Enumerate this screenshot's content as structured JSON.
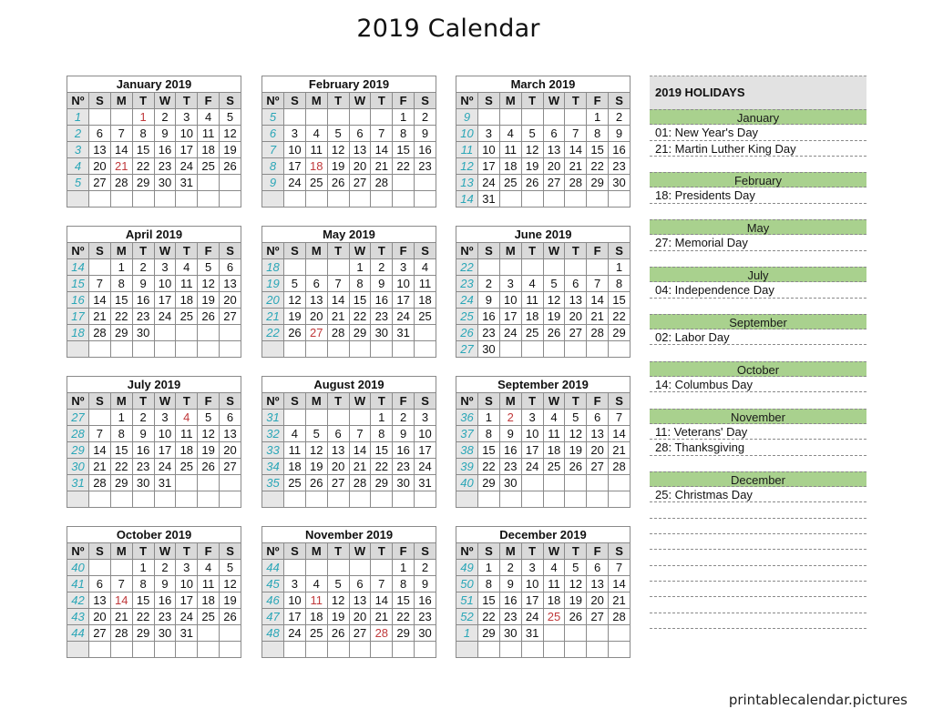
{
  "title": "2019 Calendar",
  "footer": "printablecalendar.pictures",
  "colors": {
    "holiday_text": "#c0393b",
    "week_number": "#2aa6b7",
    "holiday_band": "#a9d18e",
    "header_gray": "#d9d9d9"
  },
  "dow_labels": [
    "Nº",
    "S",
    "M",
    "T",
    "W",
    "T",
    "F",
    "S"
  ],
  "months": [
    {
      "name": "January 2019",
      "weeks": [
        {
          "wk": "1",
          "days": [
            "",
            "",
            "1",
            "2",
            "3",
            "4",
            "5"
          ]
        },
        {
          "wk": "2",
          "days": [
            "6",
            "7",
            "8",
            "9",
            "10",
            "11",
            "12"
          ]
        },
        {
          "wk": "3",
          "days": [
            "13",
            "14",
            "15",
            "16",
            "17",
            "18",
            "19"
          ]
        },
        {
          "wk": "4",
          "days": [
            "20",
            "21",
            "22",
            "23",
            "24",
            "25",
            "26"
          ]
        },
        {
          "wk": "5",
          "days": [
            "27",
            "28",
            "29",
            "30",
            "31",
            "",
            ""
          ]
        },
        {
          "wk": "",
          "days": [
            "",
            "",
            "",
            "",
            "",
            "",
            ""
          ]
        }
      ],
      "holidays": [
        "1",
        "21"
      ]
    },
    {
      "name": "February 2019",
      "weeks": [
        {
          "wk": "5",
          "days": [
            "",
            "",
            "",
            "",
            "",
            "1",
            "2"
          ]
        },
        {
          "wk": "6",
          "days": [
            "3",
            "4",
            "5",
            "6",
            "7",
            "8",
            "9"
          ]
        },
        {
          "wk": "7",
          "days": [
            "10",
            "11",
            "12",
            "13",
            "14",
            "15",
            "16"
          ]
        },
        {
          "wk": "8",
          "days": [
            "17",
            "18",
            "19",
            "20",
            "21",
            "22",
            "23"
          ]
        },
        {
          "wk": "9",
          "days": [
            "24",
            "25",
            "26",
            "27",
            "28",
            "",
            ""
          ]
        },
        {
          "wk": "",
          "days": [
            "",
            "",
            "",
            "",
            "",
            "",
            ""
          ]
        }
      ],
      "holidays": [
        "18"
      ]
    },
    {
      "name": "March 2019",
      "weeks": [
        {
          "wk": "9",
          "days": [
            "",
            "",
            "",
            "",
            "",
            "1",
            "2"
          ]
        },
        {
          "wk": "10",
          "days": [
            "3",
            "4",
            "5",
            "6",
            "7",
            "8",
            "9"
          ]
        },
        {
          "wk": "11",
          "days": [
            "10",
            "11",
            "12",
            "13",
            "14",
            "15",
            "16"
          ]
        },
        {
          "wk": "12",
          "days": [
            "17",
            "18",
            "19",
            "20",
            "21",
            "22",
            "23"
          ]
        },
        {
          "wk": "13",
          "days": [
            "24",
            "25",
            "26",
            "27",
            "28",
            "29",
            "30"
          ]
        },
        {
          "wk": "14",
          "days": [
            "31",
            "",
            "",
            "",
            "",
            "",
            ""
          ]
        }
      ],
      "holidays": []
    },
    {
      "name": "April 2019",
      "weeks": [
        {
          "wk": "14",
          "days": [
            "",
            "1",
            "2",
            "3",
            "4",
            "5",
            "6"
          ]
        },
        {
          "wk": "15",
          "days": [
            "7",
            "8",
            "9",
            "10",
            "11",
            "12",
            "13"
          ]
        },
        {
          "wk": "16",
          "days": [
            "14",
            "15",
            "16",
            "17",
            "18",
            "19",
            "20"
          ]
        },
        {
          "wk": "17",
          "days": [
            "21",
            "22",
            "23",
            "24",
            "25",
            "26",
            "27"
          ]
        },
        {
          "wk": "18",
          "days": [
            "28",
            "29",
            "30",
            "",
            "",
            "",
            ""
          ]
        },
        {
          "wk": "",
          "days": [
            "",
            "",
            "",
            "",
            "",
            "",
            ""
          ]
        }
      ],
      "holidays": []
    },
    {
      "name": "May 2019",
      "weeks": [
        {
          "wk": "18",
          "days": [
            "",
            "",
            "",
            "1",
            "2",
            "3",
            "4"
          ]
        },
        {
          "wk": "19",
          "days": [
            "5",
            "6",
            "7",
            "8",
            "9",
            "10",
            "11"
          ]
        },
        {
          "wk": "20",
          "days": [
            "12",
            "13",
            "14",
            "15",
            "16",
            "17",
            "18"
          ]
        },
        {
          "wk": "21",
          "days": [
            "19",
            "20",
            "21",
            "22",
            "23",
            "24",
            "25"
          ]
        },
        {
          "wk": "22",
          "days": [
            "26",
            "27",
            "28",
            "29",
            "30",
            "31",
            ""
          ]
        },
        {
          "wk": "",
          "days": [
            "",
            "",
            "",
            "",
            "",
            "",
            ""
          ]
        }
      ],
      "holidays": [
        "27"
      ]
    },
    {
      "name": "June 2019",
      "weeks": [
        {
          "wk": "22",
          "days": [
            "",
            "",
            "",
            "",
            "",
            "",
            "1"
          ]
        },
        {
          "wk": "23",
          "days": [
            "2",
            "3",
            "4",
            "5",
            "6",
            "7",
            "8"
          ]
        },
        {
          "wk": "24",
          "days": [
            "9",
            "10",
            "11",
            "12",
            "13",
            "14",
            "15"
          ]
        },
        {
          "wk": "25",
          "days": [
            "16",
            "17",
            "18",
            "19",
            "20",
            "21",
            "22"
          ]
        },
        {
          "wk": "26",
          "days": [
            "23",
            "24",
            "25",
            "26",
            "27",
            "28",
            "29"
          ]
        },
        {
          "wk": "27",
          "days": [
            "30",
            "",
            "",
            "",
            "",
            "",
            ""
          ]
        }
      ],
      "holidays": []
    },
    {
      "name": "July 2019",
      "weeks": [
        {
          "wk": "27",
          "days": [
            "",
            "1",
            "2",
            "3",
            "4",
            "5",
            "6"
          ]
        },
        {
          "wk": "28",
          "days": [
            "7",
            "8",
            "9",
            "10",
            "11",
            "12",
            "13"
          ]
        },
        {
          "wk": "29",
          "days": [
            "14",
            "15",
            "16",
            "17",
            "18",
            "19",
            "20"
          ]
        },
        {
          "wk": "30",
          "days": [
            "21",
            "22",
            "23",
            "24",
            "25",
            "26",
            "27"
          ]
        },
        {
          "wk": "31",
          "days": [
            "28",
            "29",
            "30",
            "31",
            "",
            "",
            ""
          ]
        },
        {
          "wk": "",
          "days": [
            "",
            "",
            "",
            "",
            "",
            "",
            ""
          ]
        }
      ],
      "holidays": [
        "4"
      ]
    },
    {
      "name": "August 2019",
      "weeks": [
        {
          "wk": "31",
          "days": [
            "",
            "",
            "",
            "",
            "1",
            "2",
            "3"
          ]
        },
        {
          "wk": "32",
          "days": [
            "4",
            "5",
            "6",
            "7",
            "8",
            "9",
            "10"
          ]
        },
        {
          "wk": "33",
          "days": [
            "11",
            "12",
            "13",
            "14",
            "15",
            "16",
            "17"
          ]
        },
        {
          "wk": "34",
          "days": [
            "18",
            "19",
            "20",
            "21",
            "22",
            "23",
            "24"
          ]
        },
        {
          "wk": "35",
          "days": [
            "25",
            "26",
            "27",
            "28",
            "29",
            "30",
            "31"
          ]
        },
        {
          "wk": "",
          "days": [
            "",
            "",
            "",
            "",
            "",
            "",
            ""
          ]
        }
      ],
      "holidays": []
    },
    {
      "name": "September 2019",
      "weeks": [
        {
          "wk": "36",
          "days": [
            "1",
            "2",
            "3",
            "4",
            "5",
            "6",
            "7"
          ]
        },
        {
          "wk": "37",
          "days": [
            "8",
            "9",
            "10",
            "11",
            "12",
            "13",
            "14"
          ]
        },
        {
          "wk": "38",
          "days": [
            "15",
            "16",
            "17",
            "18",
            "19",
            "20",
            "21"
          ]
        },
        {
          "wk": "39",
          "days": [
            "22",
            "23",
            "24",
            "25",
            "26",
            "27",
            "28"
          ]
        },
        {
          "wk": "40",
          "days": [
            "29",
            "30",
            "",
            "",
            "",
            "",
            ""
          ]
        },
        {
          "wk": "",
          "days": [
            "",
            "",
            "",
            "",
            "",
            "",
            ""
          ]
        }
      ],
      "holidays": [
        "2"
      ]
    },
    {
      "name": "October 2019",
      "weeks": [
        {
          "wk": "40",
          "days": [
            "",
            "",
            "1",
            "2",
            "3",
            "4",
            "5"
          ]
        },
        {
          "wk": "41",
          "days": [
            "6",
            "7",
            "8",
            "9",
            "10",
            "11",
            "12"
          ]
        },
        {
          "wk": "42",
          "days": [
            "13",
            "14",
            "15",
            "16",
            "17",
            "18",
            "19"
          ]
        },
        {
          "wk": "43",
          "days": [
            "20",
            "21",
            "22",
            "23",
            "24",
            "25",
            "26"
          ]
        },
        {
          "wk": "44",
          "days": [
            "27",
            "28",
            "29",
            "30",
            "31",
            "",
            ""
          ]
        },
        {
          "wk": "",
          "days": [
            "",
            "",
            "",
            "",
            "",
            "",
            ""
          ]
        }
      ],
      "holidays": [
        "14"
      ]
    },
    {
      "name": "November 2019",
      "weeks": [
        {
          "wk": "44",
          "days": [
            "",
            "",
            "",
            "",
            "",
            "1",
            "2"
          ]
        },
        {
          "wk": "45",
          "days": [
            "3",
            "4",
            "5",
            "6",
            "7",
            "8",
            "9"
          ]
        },
        {
          "wk": "46",
          "days": [
            "10",
            "11",
            "12",
            "13",
            "14",
            "15",
            "16"
          ]
        },
        {
          "wk": "47",
          "days": [
            "17",
            "18",
            "19",
            "20",
            "21",
            "22",
            "23"
          ]
        },
        {
          "wk": "48",
          "days": [
            "24",
            "25",
            "26",
            "27",
            "28",
            "29",
            "30"
          ]
        },
        {
          "wk": "",
          "days": [
            "",
            "",
            "",
            "",
            "",
            "",
            ""
          ]
        }
      ],
      "holidays": [
        "11",
        "28"
      ]
    },
    {
      "name": "December 2019",
      "weeks": [
        {
          "wk": "49",
          "days": [
            "1",
            "2",
            "3",
            "4",
            "5",
            "6",
            "7"
          ]
        },
        {
          "wk": "50",
          "days": [
            "8",
            "9",
            "10",
            "11",
            "12",
            "13",
            "14"
          ]
        },
        {
          "wk": "51",
          "days": [
            "15",
            "16",
            "17",
            "18",
            "19",
            "20",
            "21"
          ]
        },
        {
          "wk": "52",
          "days": [
            "22",
            "23",
            "24",
            "25",
            "26",
            "27",
            "28"
          ]
        },
        {
          "wk": "1",
          "days": [
            "29",
            "30",
            "31",
            "",
            "",
            "",
            ""
          ]
        },
        {
          "wk": "",
          "days": [
            "",
            "",
            "",
            "",
            "",
            "",
            ""
          ]
        }
      ],
      "holidays": [
        "25"
      ]
    }
  ],
  "holidays_panel": {
    "heading": "2019 HOLIDAYS",
    "rows": [
      {
        "type": "band",
        "text": "January"
      },
      {
        "type": "item",
        "text": "01: New Year's Day"
      },
      {
        "type": "item",
        "text": "21: Martin Luther King Day"
      },
      {
        "type": "blank",
        "text": ""
      },
      {
        "type": "band",
        "text": "February"
      },
      {
        "type": "item",
        "text": "18: Presidents Day"
      },
      {
        "type": "blank",
        "text": ""
      },
      {
        "type": "band",
        "text": "May"
      },
      {
        "type": "item",
        "text": "27: Memorial Day"
      },
      {
        "type": "blank",
        "text": ""
      },
      {
        "type": "band",
        "text": "July"
      },
      {
        "type": "item",
        "text": "04: Independence Day"
      },
      {
        "type": "blank",
        "text": ""
      },
      {
        "type": "band",
        "text": "September"
      },
      {
        "type": "item",
        "text": "02: Labor Day"
      },
      {
        "type": "blank",
        "text": ""
      },
      {
        "type": "band",
        "text": "October"
      },
      {
        "type": "item",
        "text": "14: Columbus Day"
      },
      {
        "type": "blank",
        "text": ""
      },
      {
        "type": "band",
        "text": "November"
      },
      {
        "type": "item",
        "text": "11: Veterans' Day"
      },
      {
        "type": "item",
        "text": "28: Thanksgiving"
      },
      {
        "type": "blank",
        "text": ""
      },
      {
        "type": "band",
        "text": "December"
      },
      {
        "type": "item",
        "text": "25: Christmas Day"
      },
      {
        "type": "line",
        "text": ""
      },
      {
        "type": "line",
        "text": ""
      },
      {
        "type": "line",
        "text": ""
      },
      {
        "type": "line",
        "text": ""
      },
      {
        "type": "line",
        "text": ""
      },
      {
        "type": "line",
        "text": ""
      },
      {
        "type": "line",
        "text": ""
      },
      {
        "type": "line",
        "text": ""
      }
    ]
  }
}
